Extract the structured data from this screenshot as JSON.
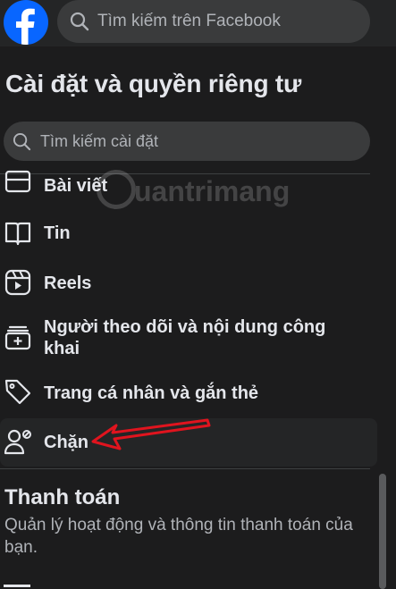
{
  "top": {
    "search_placeholder": "Tìm kiếm trên Facebook"
  },
  "page_title": "Cài đặt và quyền riêng tư",
  "settings_search_placeholder": "Tìm kiếm cài đặt",
  "items": [
    {
      "label": "Bài viết",
      "icon": "post-icon"
    },
    {
      "label": "Tin",
      "icon": "book-icon"
    },
    {
      "label": "Reels",
      "icon": "reels-icon"
    },
    {
      "label": "Người theo dõi và nội dung công khai",
      "icon": "add-box-icon"
    },
    {
      "label": "Trang cá nhân và gắn thẻ",
      "icon": "tag-icon"
    },
    {
      "label": "Chặn",
      "icon": "block-user-icon"
    }
  ],
  "payment": {
    "title": "Thanh toán",
    "description": "Quản lý hoạt động và thông tin thanh toán của bạn."
  },
  "watermark": "uantrimang",
  "colors": {
    "background": "#1c1c1d",
    "brand": "#0866ff",
    "annotation": "#e0141e"
  }
}
